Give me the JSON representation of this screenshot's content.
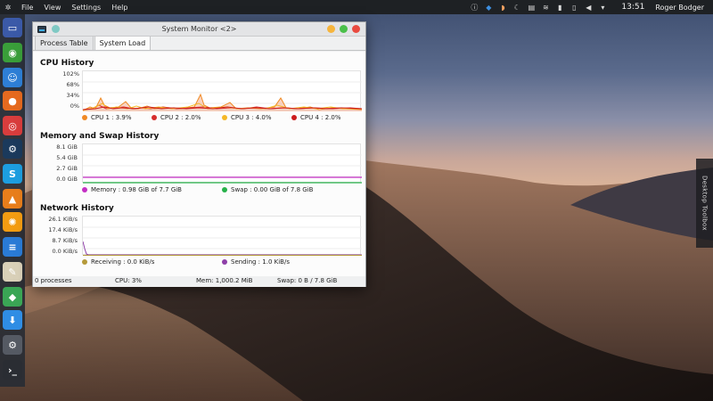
{
  "top_panel": {
    "menu": [
      "File",
      "View",
      "Settings",
      "Help"
    ],
    "tray_icons": [
      "info-icon",
      "dropbox-icon",
      "weather-icon",
      "moon-icon",
      "clipboard-icon",
      "wifi-icon",
      "battery-icon",
      "phone-icon",
      "volume-icon",
      "chevron-down-icon"
    ],
    "clock": "13:51",
    "user": "Roger Bodger"
  },
  "dock": {
    "apps": [
      {
        "name": "dolphin-icon",
        "color": "#3b5aa8",
        "glyph": "▭"
      },
      {
        "name": "screenshot-icon",
        "color": "#3a9e3a",
        "glyph": "◉"
      },
      {
        "name": "finder-icon",
        "color": "#2e7fd6",
        "glyph": "☺"
      },
      {
        "name": "firefox-icon",
        "color": "#e66a1f",
        "glyph": "●"
      },
      {
        "name": "chrome-icon",
        "color": "#d93d3d",
        "glyph": "◎"
      },
      {
        "name": "steam-icon",
        "color": "#1b3a5c",
        "glyph": "⚙"
      },
      {
        "name": "skype-icon",
        "color": "#1d9ee0",
        "glyph": "S"
      },
      {
        "name": "vlc-icon",
        "color": "#e87e1b",
        "glyph": "▲"
      },
      {
        "name": "orange-app-icon",
        "color": "#f39c12",
        "glyph": "✺"
      },
      {
        "name": "docs-icon",
        "color": "#2a7bd6",
        "glyph": "≡"
      },
      {
        "name": "text-editor-icon",
        "color": "#d9d0b8",
        "glyph": "✎"
      },
      {
        "name": "maps-icon",
        "color": "#3aa655",
        "glyph": "◆"
      },
      {
        "name": "store-icon",
        "color": "#2f8de4",
        "glyph": "⬇"
      },
      {
        "name": "settings-icon",
        "color": "#555a63",
        "glyph": "⚙"
      },
      {
        "name": "terminal-icon",
        "color": "#2a2d33",
        "glyph": "›_"
      }
    ]
  },
  "toolbox": {
    "label": "Desktop Toolbox"
  },
  "window": {
    "title": "System Monitor <2>",
    "tabs": [
      "Process Table",
      "System Load"
    ],
    "active_tab": "System Load",
    "button_colors": {
      "minimize": "#f6b53d",
      "maximize": "#4bc04a",
      "close": "#e94a3f"
    },
    "cpu": {
      "title": "CPU History",
      "y_labels": [
        "102%",
        "68%",
        "34%",
        "0%"
      ],
      "legend": [
        {
          "label": "CPU 1 : 3.9%",
          "color": "#f08a24"
        },
        {
          "label": "CPU 2 : 2.0%",
          "color": "#d62d2d"
        },
        {
          "label": "CPU 3 : 4.0%",
          "color": "#f5b827"
        },
        {
          "label": "CPU 4 : 2.0%",
          "color": "#cc1c1c"
        }
      ]
    },
    "memory": {
      "title": "Memory and Swap History",
      "y_labels": [
        "8.1 GiB",
        "5.4 GiB",
        "2.7 GiB",
        "0.0 GiB"
      ],
      "legend": [
        {
          "label": "Memory : 0.98 GiB of 7.7 GiB",
          "color": "#c42fc4"
        },
        {
          "label": "Swap : 0.00 GiB of 7.8 GiB",
          "color": "#27b14a"
        }
      ]
    },
    "network": {
      "title": "Network History",
      "y_labels": [
        "26.1 KiB/s",
        "17.4 KiB/s",
        "8.7 KiB/s",
        "0.0 KiB/s"
      ],
      "legend": [
        {
          "label": "Receiving : 0.0 KiB/s",
          "color": "#b59a3a"
        },
        {
          "label": "Sending : 1.0 KiB/s",
          "color": "#8e3fa8"
        }
      ]
    },
    "status": {
      "processes": "0 processes",
      "cpu": "CPU: 3%",
      "mem": "Mem: 1,000.2 MiB",
      "swap": "Swap: 0 B / 7.8 GiB"
    }
  }
}
